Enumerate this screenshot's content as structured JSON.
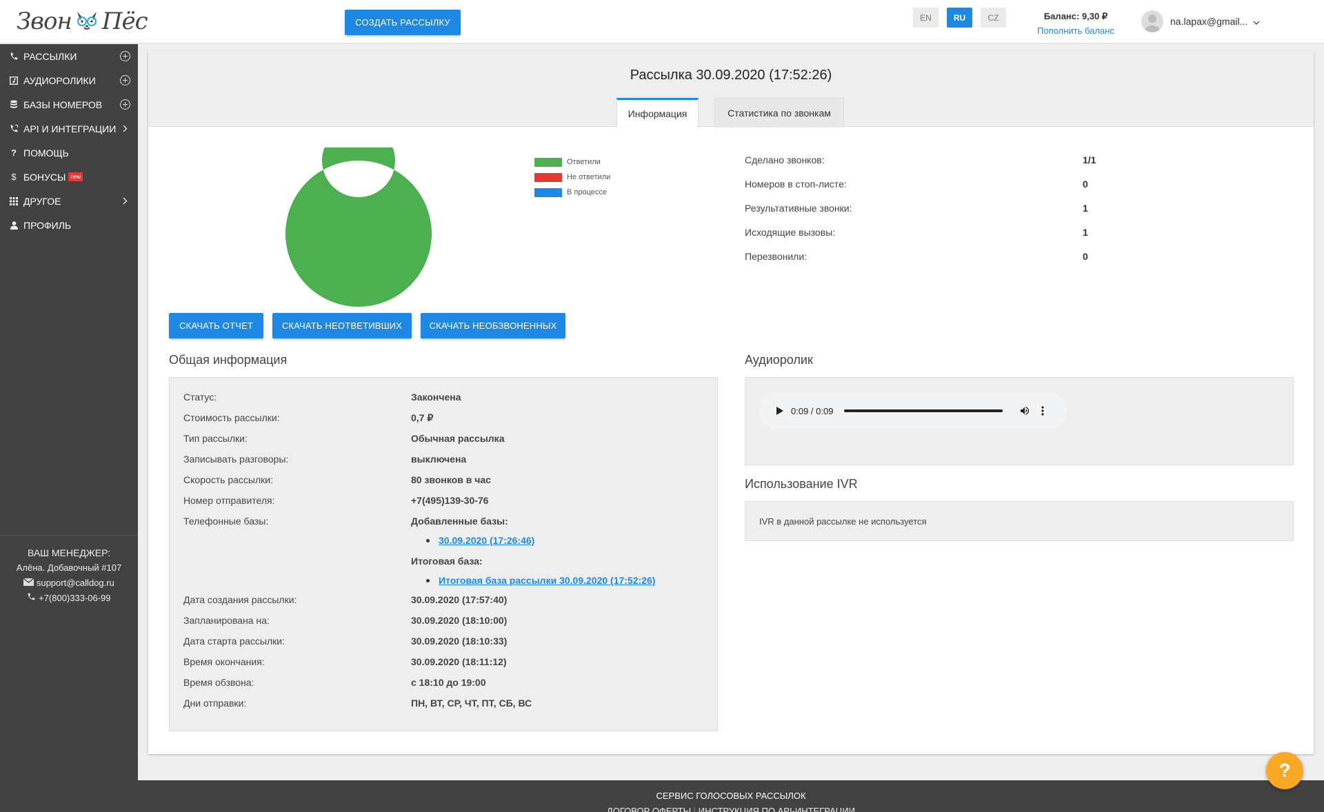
{
  "header": {
    "logo_left": "Звон",
    "logo_right": "Пёс",
    "create_button": "СОЗДАТЬ РАССЫЛКУ",
    "languages": [
      {
        "code": "EN",
        "active": false
      },
      {
        "code": "RU",
        "active": true
      },
      {
        "code": "CZ",
        "active": false
      }
    ],
    "balance_label": "Баланс: 9,30 ₽",
    "topup_link": "Пополнить баланс",
    "user_email": "na.lapax@gmail..."
  },
  "sidebar": {
    "items": [
      {
        "label": "РАССЫЛКИ",
        "icon": "phone-icon",
        "right": "plus"
      },
      {
        "label": "АУДИОРОЛИКИ",
        "icon": "audio-file-icon",
        "right": "plus"
      },
      {
        "label": "БАЗЫ НОМЕРОВ",
        "icon": "database-icon",
        "right": "plus"
      },
      {
        "label": "API И ИНТЕГРАЦИИ",
        "icon": "phone-forward-icon",
        "right": "chevron"
      },
      {
        "label": "ПОМОЩЬ",
        "icon": "question-icon",
        "right": ""
      },
      {
        "label": "БОНУСЫ",
        "icon": "dollar-icon",
        "right": "",
        "badge": "new"
      },
      {
        "label": "ДРУГОЕ",
        "icon": "grid-icon",
        "right": "chevron"
      },
      {
        "label": "ПРОФИЛЬ",
        "icon": "person-icon",
        "right": ""
      }
    ],
    "manager": {
      "title": "ВАШ МЕНЕДЖЕР:",
      "name": "Алёна. Добавочный #107",
      "email": "support@calldog.ru",
      "phone": "+7(800)333-06-99"
    }
  },
  "main": {
    "title": "Рассылка 30.09.2020 (17:52:26)",
    "tabs": [
      {
        "label": "Информация",
        "active": true
      },
      {
        "label": "Статистика по звонкам",
        "active": false
      }
    ],
    "chart_data": {
      "type": "pie",
      "title": "",
      "categories": [
        "Ответили",
        "Не ответили",
        "В процессе"
      ],
      "values": [
        1,
        0,
        0
      ],
      "colors": [
        "#4caf50",
        "#e53935",
        "#1e88e5"
      ],
      "style": "donut",
      "legend_position": "right"
    },
    "stats": [
      {
        "label": "Сделано звонков:",
        "value": "1/1"
      },
      {
        "label": "Номеров в стоп-листе:",
        "value": "0"
      },
      {
        "label": "Результативные звонки:",
        "value": "1"
      },
      {
        "label": "Исходящие вызовы:",
        "value": "1"
      },
      {
        "label": "Перезвонили:",
        "value": "0"
      }
    ],
    "buttons": {
      "report": "СКАЧАТЬ ОТЧЕТ",
      "unanswered": "СКАЧАТЬ НЕОТВЕТИВШИХ",
      "not_called": "СКАЧАТЬ НЕОБЗВОНЕННЫХ"
    },
    "general": {
      "title": "Общая информация",
      "rows": [
        {
          "label": "Статус:",
          "value": "Закончена"
        },
        {
          "label": "Стоимость рассылки:",
          "value": "0,7 ₽"
        },
        {
          "label": "Тип рассылки:",
          "value": "Обычная рассылка"
        },
        {
          "label": "Записывать разговоры:",
          "value": "выключена"
        },
        {
          "label": "Скорость рассылки:",
          "value": "80 звонков в час"
        },
        {
          "label": "Номер отправителя:",
          "value": "+7(495)139-30-76"
        },
        {
          "label": "Телефонные базы:",
          "value": "Добавленные базы:"
        }
      ],
      "added_base_link": "30.09.2020 (17:26:46)",
      "final_base_label": "Итоговая база:",
      "final_base_link": "Итоговая база рассылки 30.09.2020 (17:52:26)",
      "rows2": [
        {
          "label": "Дата создания рассылки:",
          "value": "30.09.2020 (17:57:40)"
        },
        {
          "label": "Запланирована на:",
          "value": "30.09.2020 (18:10:00)"
        },
        {
          "label": "Дата старта рассылки:",
          "value": "30.09.2020 (18:10:33)"
        },
        {
          "label": "Время окончания:",
          "value": "30.09.2020 (18:11:12)"
        },
        {
          "label": "Время обзвона:",
          "value": "с 18:10 до 19:00"
        },
        {
          "label": "Дни отправки:",
          "value": "ПН, ВТ, СР, ЧТ, ПТ, СБ, ВС"
        }
      ]
    },
    "audio": {
      "title": "Аудиоролик",
      "time": "0:09 / 0:09",
      "progress": 1.0
    },
    "ivr": {
      "title": "Использование IVR",
      "text": "IVR в данной рассылке не используется"
    }
  },
  "footer": {
    "title": "СЕРВИС ГОЛОСОВЫХ РАССЫЛОК",
    "link1": "ДОГОВОР ОФЕРТЫ",
    "separator": "|",
    "link2": "ИНСТРУКЦИЯ ПО API-ИНТЕГРАЦИИ"
  },
  "help_fab": "?"
}
